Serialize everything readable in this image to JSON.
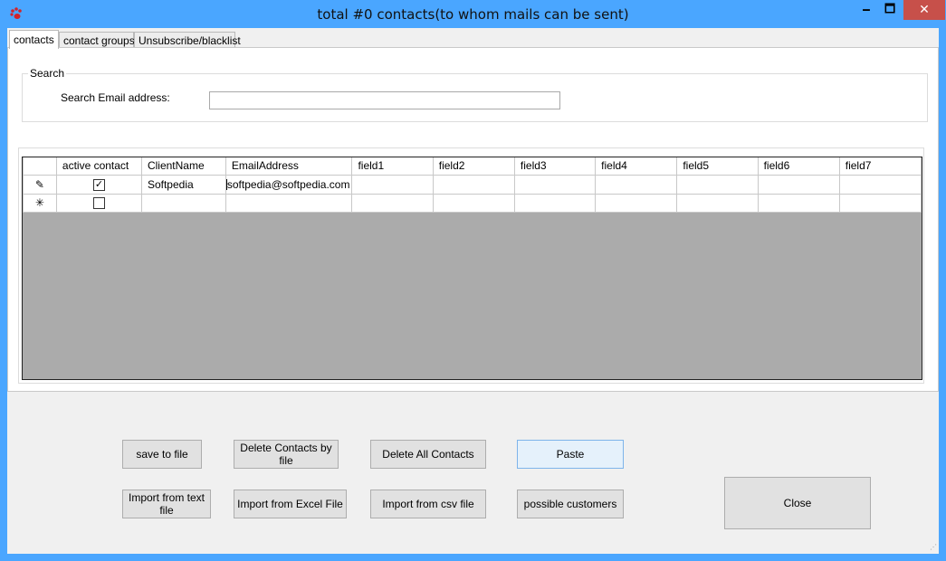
{
  "window": {
    "title": "total #0 contacts(to whom mails can be sent)",
    "minimize": "🗕",
    "maximize": "🗖",
    "close": "✕"
  },
  "tabs": [
    {
      "label": "contacts",
      "active": true
    },
    {
      "label": "contact groups",
      "active": false
    },
    {
      "label": "Unsubscribe/blacklist",
      "active": false
    }
  ],
  "search": {
    "group_label": "Search",
    "email_label": "Search Email  address:",
    "email_value": ""
  },
  "grid": {
    "columns": [
      "active contact",
      "ClientName",
      "EmailAddress",
      "field1",
      "field2",
      "field3",
      "field4",
      "field5",
      "field6",
      "field7"
    ],
    "rows": [
      {
        "row_marker": "✎",
        "active": true,
        "client_name": "Softpedia",
        "email": "softpedia@softpedia.com",
        "fields": [
          "",
          "",
          "",
          "",
          "",
          "",
          ""
        ]
      },
      {
        "row_marker": "✳",
        "active": false,
        "client_name": "",
        "email": "",
        "fields": [
          "",
          "",
          "",
          "",
          "",
          "",
          ""
        ]
      }
    ]
  },
  "buttons": {
    "save_to_file": "save to file",
    "delete_contacts_by_file": "Delete Contacts by file",
    "delete_all_contacts": "Delete All Contacts",
    "paste": "Paste",
    "import_text": "Import from text file",
    "import_excel": "Import from Excel File",
    "import_csv": "Import from csv file",
    "possible_customers": "possible customers",
    "close": "Close"
  },
  "colors": {
    "titlebar": "#4aa6ff",
    "close_button": "#c7504a",
    "grid_background": "#ababab"
  }
}
